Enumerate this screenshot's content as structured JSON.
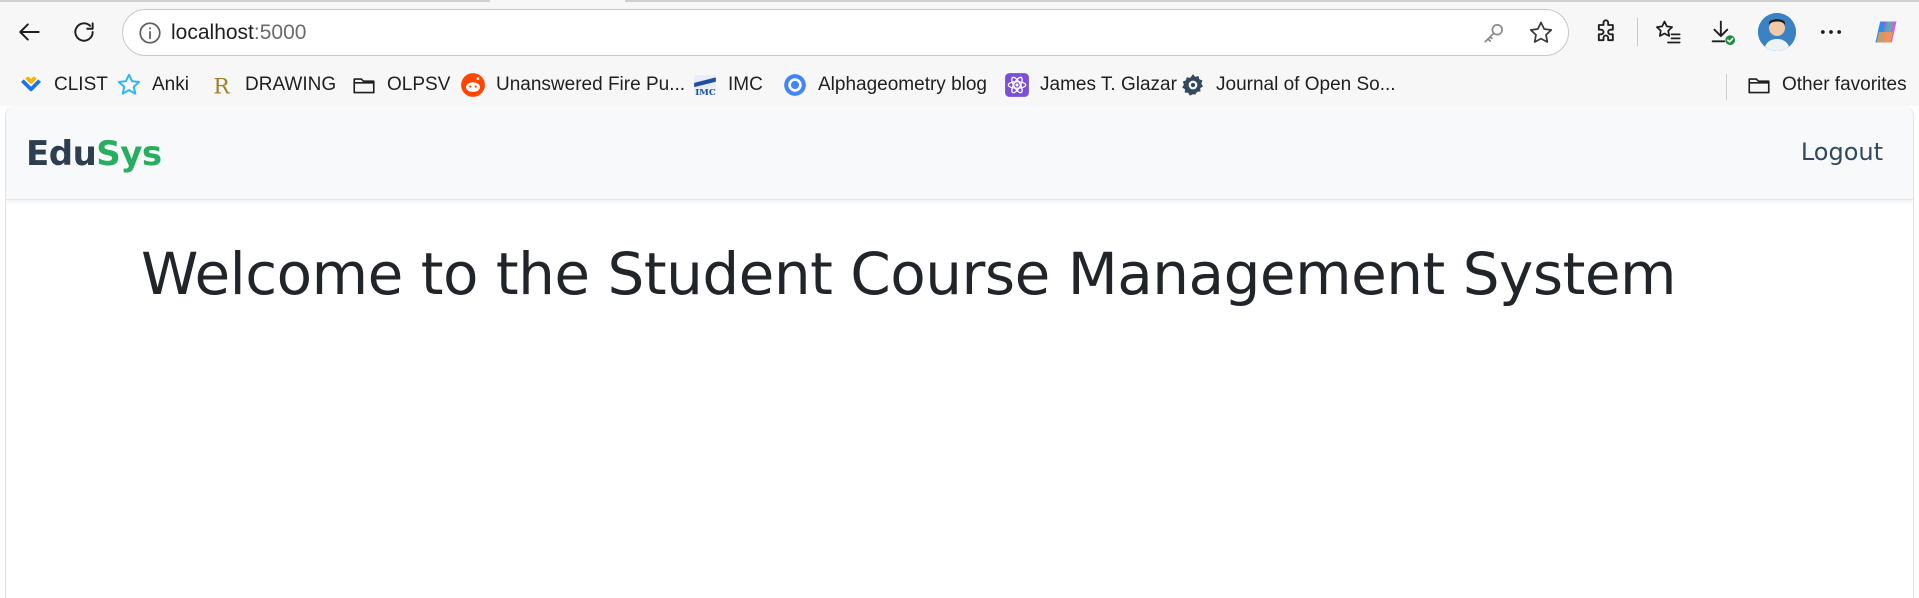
{
  "browser": {
    "url_host": "localhost",
    "url_port": ":5000",
    "bookmarks": [
      {
        "label": "CLIST",
        "icon": "clist-icon"
      },
      {
        "label": "Anki",
        "icon": "anki-star-icon"
      },
      {
        "label": "DRAWING",
        "icon": "r-letter-icon"
      },
      {
        "label": "OLPSV",
        "icon": "folder-icon"
      },
      {
        "label": "Unanswered Fire Pu...",
        "icon": "reddit-icon"
      },
      {
        "label": "IMC",
        "icon": "imc-icon"
      },
      {
        "label": "Alphageometry blog",
        "icon": "blue-circle-icon"
      },
      {
        "label": "James T. Glazar",
        "icon": "react-icon"
      },
      {
        "label": "Journal of Open So...",
        "icon": "gear-icon"
      }
    ],
    "other_favorites": "Other favorites"
  },
  "app": {
    "brand_part1": "Edu",
    "brand_part2": "Sys",
    "brand_color1": "#2c3e50",
    "brand_color2": "#27ae60",
    "logout_label": "Logout",
    "welcome_heading": "Welcome to the Student Course Management System"
  }
}
